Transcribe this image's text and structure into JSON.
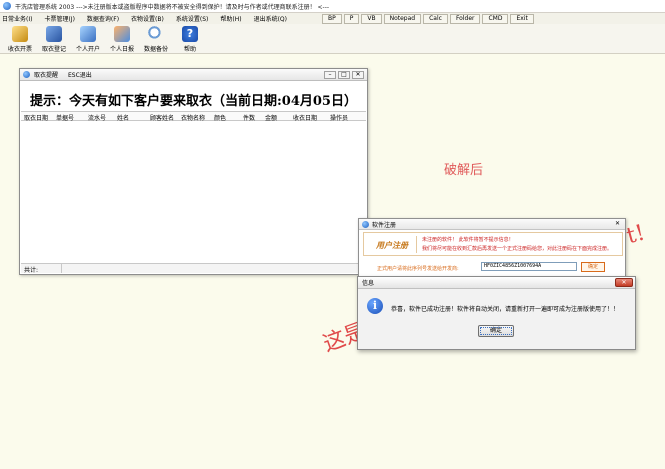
{
  "app": {
    "title": "干洗店管理系统 2003 --->未注册版本或盗版程序中数据将不被安全得到保护！请及时与作者或代理商联系注册！ <---"
  },
  "menu": [
    "日常业务(I)",
    "卡票管理(J)",
    "数据查询(F)",
    "衣物设置(B)",
    "系统设置(S)",
    "帮助(H)",
    "退出系统(Q)"
  ],
  "quick_buttons": [
    "BP",
    "P",
    "VB",
    "Notepad",
    "Calc",
    "Folder",
    "CMD",
    "Exit"
  ],
  "toolbar": [
    {
      "label": "收衣开票",
      "icon": "key-icon"
    },
    {
      "label": "取衣登记",
      "icon": "register-icon"
    },
    {
      "label": "个人开户",
      "icon": "person-icon"
    },
    {
      "label": "个人日报",
      "icon": "people-icon"
    },
    {
      "label": "数据备份",
      "icon": "search-icon"
    },
    {
      "label": "帮助",
      "icon": "help-icon"
    }
  ],
  "pickup_window": {
    "title": "取衣提醒",
    "hint": "ESC退出",
    "heading": "提示：今天有如下客户要来取衣（当前日期:04月05日）",
    "columns": [
      "取衣日期",
      "单据号",
      "流水号",
      "姓名",
      "顾客姓名",
      "衣物名称",
      "颜色",
      "件数",
      "金额",
      "收衣日期",
      "操作员"
    ],
    "status_label": "共计:"
  },
  "overlay": {
    "cracked": "破解后",
    "stamp_left": "这是",
    "stamp_right": "t!"
  },
  "register_window": {
    "title": "软件注册",
    "logo": "用户注册",
    "msg1": "未注册的软件！ 此软件将暂不提示信息！",
    "msg2": "我们将尽可能在收到汇款后再发送一个正式注册码给您，对此注册码在下面完成注册。",
    "field_label": "正式用户请将此序列号发送给开发商:",
    "serial": "HF0ZIC4856Z1007694A",
    "register_button": "确定"
  },
  "info_dialog": {
    "title": "信息",
    "message": "恭喜，软件已成功注册！软件将自动关闭，请重新打开一遍即可成为注册版使用了！！",
    "ok": "确定"
  }
}
